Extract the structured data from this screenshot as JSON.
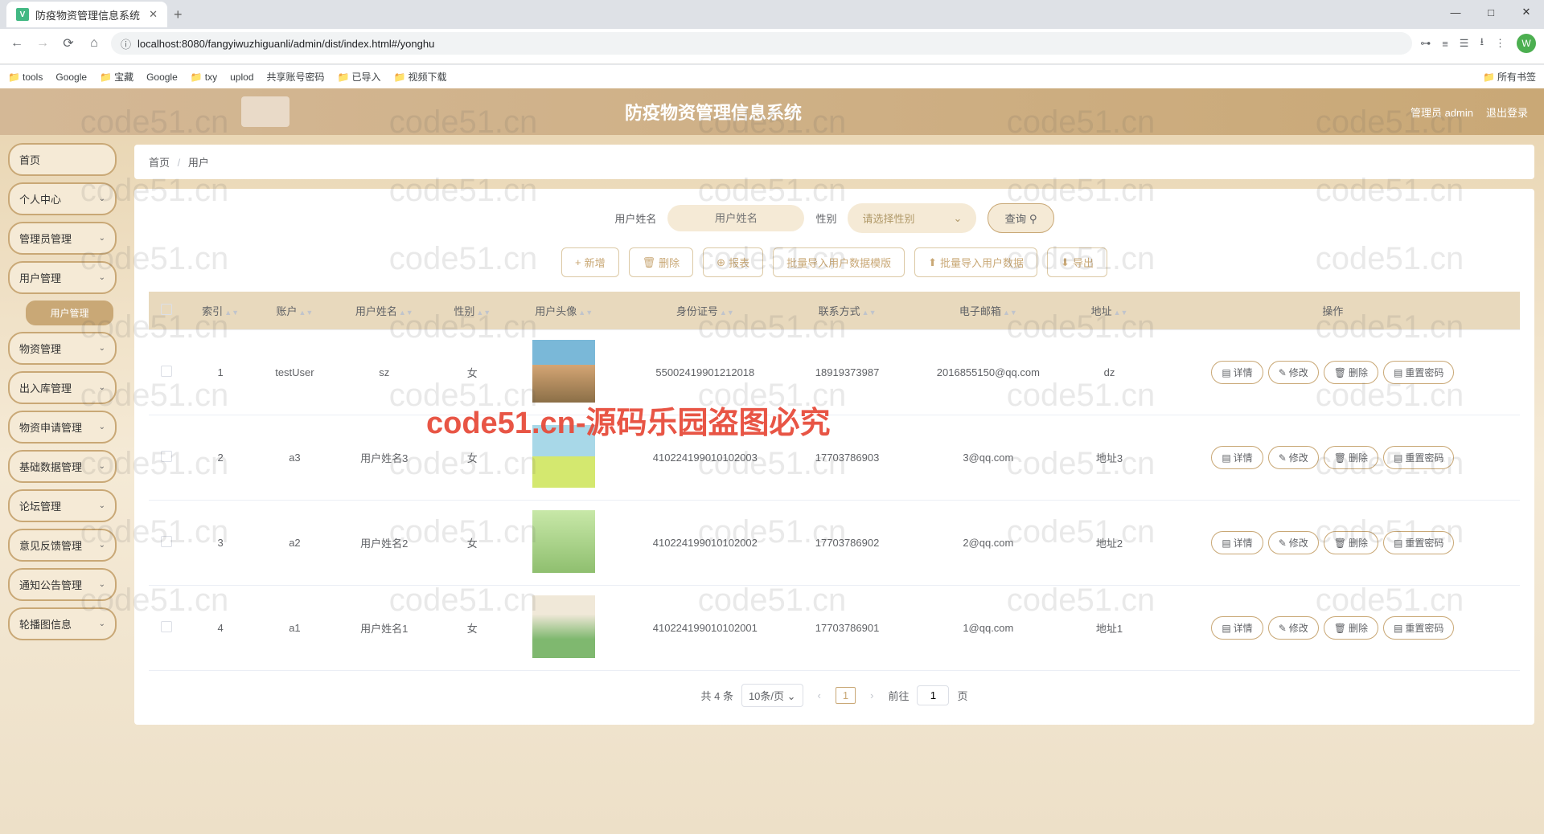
{
  "browser": {
    "tab_title": "防疫物资管理信息系统",
    "url": "localhost:8080/fangyiwuzhiguanli/admin/dist/index.html#/yonghu",
    "new_tab": "+",
    "avatar_letter": "W",
    "bookmarks": [
      "tools",
      "Google",
      "宝藏",
      "Google",
      "txy",
      "uplod",
      "共享账号密码",
      "已导入",
      "视频下载"
    ],
    "all_bookmarks": "所有书签",
    "win_min": "—",
    "win_max": "□",
    "win_close": "✕"
  },
  "header": {
    "title": "防疫物资管理信息系统",
    "admin_label": "管理员 admin",
    "logout": "退出登录"
  },
  "sidebar": {
    "items": [
      {
        "label": "首页",
        "expand": false
      },
      {
        "label": "个人中心",
        "expand": true
      },
      {
        "label": "管理员管理",
        "expand": true
      },
      {
        "label": "用户管理",
        "expand": true
      },
      {
        "label": "用户管理",
        "sub": true
      },
      {
        "label": "物资管理",
        "expand": true
      },
      {
        "label": "出入库管理",
        "expand": true
      },
      {
        "label": "物资申请管理",
        "expand": true
      },
      {
        "label": "基础数据管理",
        "expand": true
      },
      {
        "label": "论坛管理",
        "expand": true
      },
      {
        "label": "意见反馈管理",
        "expand": true
      },
      {
        "label": "通知公告管理",
        "expand": true
      },
      {
        "label": "轮播图信息",
        "expand": true
      }
    ]
  },
  "breadcrumb": {
    "home": "首页",
    "current": "用户"
  },
  "search": {
    "name_label": "用户姓名",
    "name_placeholder": "用户姓名",
    "gender_label": "性别",
    "gender_placeholder": "请选择性别",
    "btn": "查询"
  },
  "actions": {
    "add": "新增",
    "delete": "删除",
    "report": "报表",
    "import_template": "批量导入用户数据模版",
    "import_data": "批量导入用户数据",
    "export": "导出"
  },
  "table": {
    "headers": [
      "索引",
      "账户",
      "用户姓名",
      "性别",
      "用户头像",
      "身份证号",
      "联系方式",
      "电子邮箱",
      "地址",
      "操作"
    ],
    "rows": [
      {
        "idx": "1",
        "account": "testUser",
        "name": "sz",
        "gender": "女",
        "idcard": "55002419901212018",
        "phone": "18919373987",
        "email": "2016855150@qq.com",
        "addr": "dz"
      },
      {
        "idx": "2",
        "account": "a3",
        "name": "用户姓名3",
        "gender": "女",
        "idcard": "410224199010102003",
        "phone": "17703786903",
        "email": "3@qq.com",
        "addr": "地址3"
      },
      {
        "idx": "3",
        "account": "a2",
        "name": "用户姓名2",
        "gender": "女",
        "idcard": "410224199010102002",
        "phone": "17703786902",
        "email": "2@qq.com",
        "addr": "地址2"
      },
      {
        "idx": "4",
        "account": "a1",
        "name": "用户姓名1",
        "gender": "女",
        "idcard": "410224199010102001",
        "phone": "17703786901",
        "email": "1@qq.com",
        "addr": "地址1"
      }
    ],
    "ops": {
      "detail": "详情",
      "edit": "修改",
      "delete": "删除",
      "reset": "重置密码"
    }
  },
  "pagination": {
    "total": "共 4 条",
    "page_size": "10条/页",
    "current": "1",
    "goto_label": "前往",
    "page_suffix": "页",
    "goto_value": "1"
  },
  "watermark": "code51.cn",
  "watermark_red": "code51.cn-源码乐园盗图必究"
}
